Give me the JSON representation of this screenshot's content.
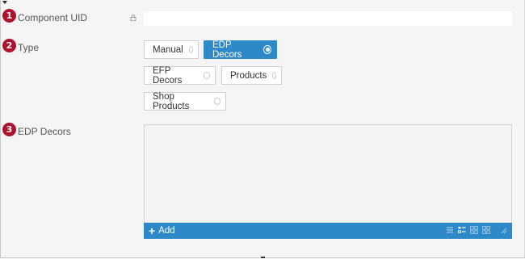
{
  "markers": [
    "1",
    "2",
    "3"
  ],
  "fields": {
    "component_uid": {
      "label": "Component UID",
      "value": ""
    },
    "type": {
      "label": "Type",
      "options": [
        {
          "label": "Manual",
          "selected": false
        },
        {
          "label": "EDP Decors",
          "selected": true
        },
        {
          "label": "EFP Decors",
          "selected": false
        },
        {
          "label": "Products",
          "selected": false
        },
        {
          "label": "Shop Products",
          "selected": false
        }
      ]
    },
    "edp_decors": {
      "label": "EDP Decors",
      "add_label": "Add",
      "add_symbol": "+"
    }
  },
  "colors": {
    "accent": "#2e89c8",
    "marker": "#b0122e",
    "background": "#f5f5f5"
  },
  "icons": [
    "lock-icon",
    "plus-icon",
    "list-view-icon",
    "tree-view-icon",
    "grid-view-icon",
    "tile-view-icon",
    "resize-handle-icon"
  ]
}
